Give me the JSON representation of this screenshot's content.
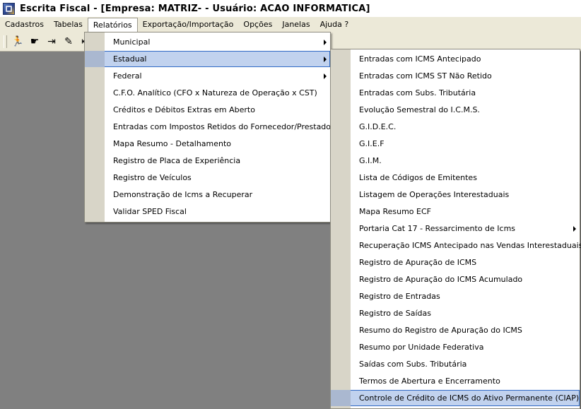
{
  "window": {
    "title": "Escrita Fiscal - [Empresa: MATRIZ-  - Usuário: ACAO INFORMATICA]"
  },
  "menubar": {
    "items": [
      "Cadastros",
      "Tabelas",
      "Relatórios",
      "Exportação/Importação",
      "Opções",
      "Janelas",
      "Ajuda ?"
    ]
  },
  "toolbar": {
    "buttons": [
      {
        "icon": "running-man-icon",
        "glyph": "🏃"
      },
      {
        "icon": "hand-icon",
        "glyph": "☛"
      },
      {
        "icon": "door-exit-icon",
        "glyph": "⇥"
      },
      {
        "icon": "pencil-icon",
        "glyph": "✎"
      },
      {
        "icon": "arrow-left-icon",
        "glyph": "⇤"
      }
    ]
  },
  "relatorios_menu": {
    "items": [
      {
        "label": "Municipal",
        "submenu": true
      },
      {
        "label": "Estadual",
        "submenu": true
      },
      {
        "label": "Federal",
        "submenu": true
      },
      {
        "label": "C.F.O. Analítico (CFO x Natureza de Operação x CST)",
        "submenu": false
      },
      {
        "label": "Créditos e Débitos Extras em Aberto",
        "submenu": false
      },
      {
        "label": "Entradas com Impostos Retidos do Fornecedor/Prestador",
        "submenu": false
      },
      {
        "label": "Mapa Resumo - Detalhamento",
        "submenu": false
      },
      {
        "label": "Registro de Placa de Experiência",
        "submenu": false
      },
      {
        "label": "Registro de Veículos",
        "submenu": false
      },
      {
        "label": "Demonstração de Icms a Recuperar",
        "submenu": false
      },
      {
        "label": "Validar SPED Fiscal",
        "submenu": false
      }
    ]
  },
  "estadual_menu": {
    "items": [
      {
        "label": "Entradas com ICMS Antecipado",
        "submenu": false
      },
      {
        "label": "Entradas com ICMS ST Não Retido",
        "submenu": false
      },
      {
        "label": "Entradas com Subs. Tributária",
        "submenu": false
      },
      {
        "label": "Evolução Semestral do I.C.M.S.",
        "submenu": false
      },
      {
        "label": "G.I.D.E.C.",
        "submenu": false
      },
      {
        "label": "G.I.E.F",
        "submenu": false
      },
      {
        "label": "G.I.M.",
        "submenu": false
      },
      {
        "label": "Lista de Códigos de Emitentes",
        "submenu": false
      },
      {
        "label": "Listagem de Operações Interestaduais",
        "submenu": false
      },
      {
        "label": "Mapa Resumo ECF",
        "submenu": false
      },
      {
        "label": "Portaria Cat 17 - Ressarcimento de Icms",
        "submenu": true
      },
      {
        "label": "Recuperação ICMS Antecipado nas Vendas Interestaduais",
        "submenu": false
      },
      {
        "label": "Registro de Apuração de ICMS",
        "submenu": false
      },
      {
        "label": "Registro de Apuração do ICMS Acumulado",
        "submenu": false
      },
      {
        "label": "Registro de Entradas",
        "submenu": false
      },
      {
        "label": "Registro de Saídas",
        "submenu": false
      },
      {
        "label": "Resumo do Registro de Apuração do ICMS",
        "submenu": false
      },
      {
        "label": "Resumo por Unidade Federativa",
        "submenu": false
      },
      {
        "label": "Saídas com Subs. Tributária",
        "submenu": false
      },
      {
        "label": "Termos de Abertura e Encerramento",
        "submenu": false
      },
      {
        "label": "Controle de Crédito de ICMS do Ativo Permanente (CIAP)",
        "submenu": false
      }
    ]
  }
}
